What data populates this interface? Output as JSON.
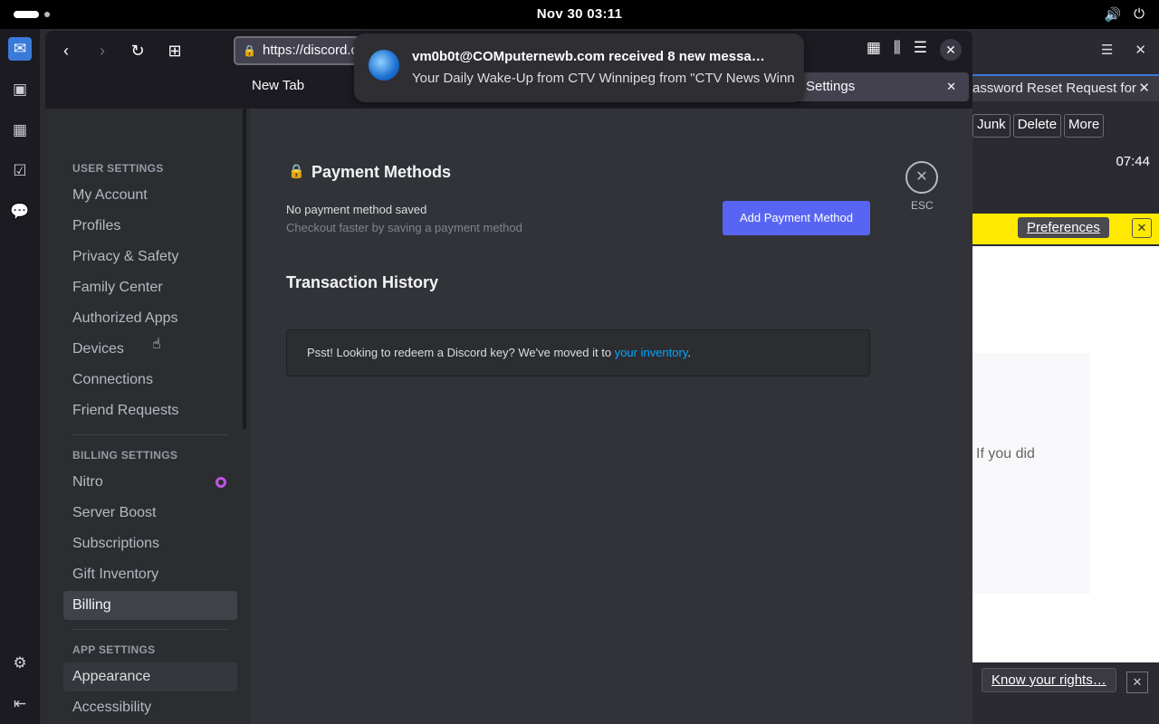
{
  "topbar": {
    "clock": "Nov 30  03:11",
    "volume_icon": "volume-icon",
    "power_icon": "power-icon"
  },
  "thunderbird": {
    "tab_title": "assword Reset Request for",
    "toolbar": [
      "Junk",
      "Delete",
      "More"
    ],
    "time": "07:44",
    "preferences_label": "Preferences",
    "body_fragment": "If you did",
    "know_rights_label": "Know your rights…"
  },
  "firefox": {
    "url": "https://discord.c",
    "tabs": [
      {
        "label": "New Tab"
      },
      {
        "label": "Settings"
      }
    ]
  },
  "notification": {
    "title": "vm0b0t@COMputernewb.com received 8 new messa…",
    "body": "Your Daily Wake-Up from CTV Winnipeg from \"CTV News Winn…"
  },
  "discord": {
    "user_settings_header": "USER SETTINGS",
    "user_items": [
      "My Account",
      "Profiles",
      "Privacy & Safety",
      "Family Center",
      "Authorized Apps",
      "Devices",
      "Connections",
      "Friend Requests"
    ],
    "billing_header": "BILLING SETTINGS",
    "billing_items": [
      "Nitro",
      "Server Boost",
      "Subscriptions",
      "Gift Inventory",
      "Billing"
    ],
    "app_header": "APP SETTINGS",
    "app_items": [
      "Appearance",
      "Accessibility"
    ],
    "payment_title": "Payment Methods",
    "no_payment": "No payment method saved",
    "no_payment_sub": "Checkout faster by saving a payment method",
    "add_payment_label": "Add Payment Method",
    "transaction_title": "Transaction History",
    "psst_text": "Psst! Looking to redeem a Discord key? We've moved it to ",
    "psst_link": "your inventory",
    "psst_end": ".",
    "esc_label": "ESC"
  }
}
